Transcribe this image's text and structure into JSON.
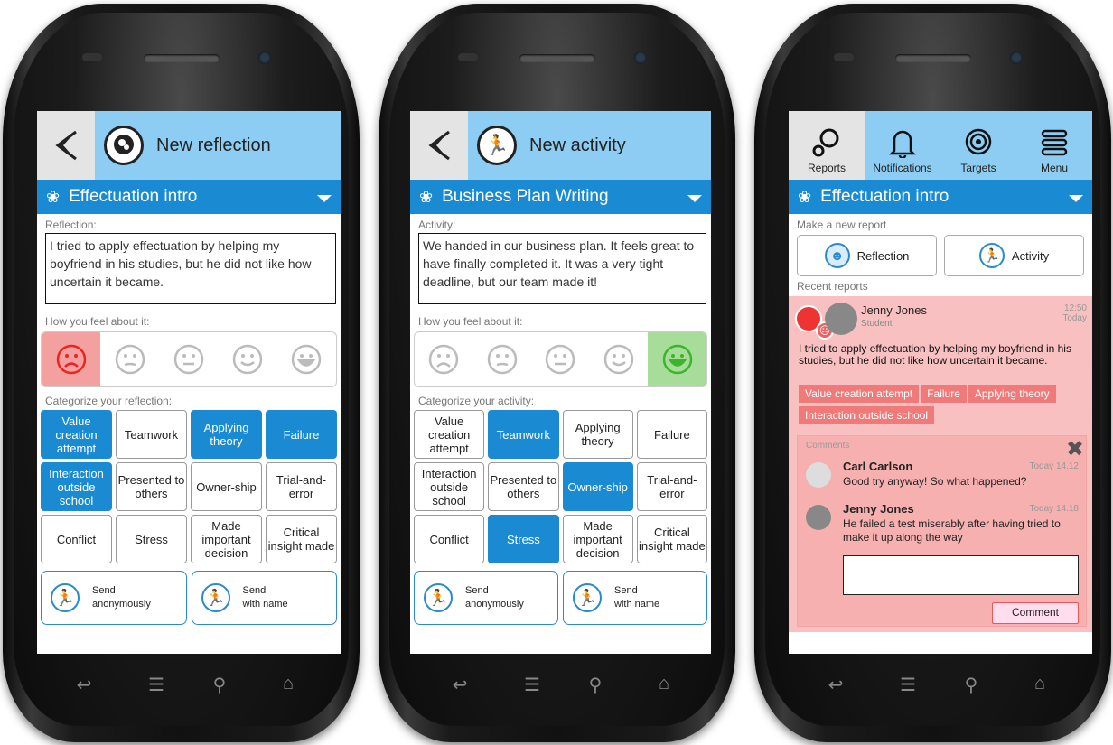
{
  "nav_icons": [
    "back-key",
    "menu-key",
    "search-key",
    "home-key"
  ],
  "phone1": {
    "title": "New reflection",
    "group": "Effectuation intro",
    "text_label": "Reflection:",
    "text_value": "I tried to apply effectuation by helping my boyfriend in his studies, but he did not like how uncertain it became.",
    "feel_label": "How you feel about it:",
    "selected_face": 0,
    "cat_label": "Categorize  your reflection:",
    "categories": [
      {
        "label": "Value creation attempt",
        "selected": true
      },
      {
        "label": "Teamwork",
        "selected": false
      },
      {
        "label": "Applying theory",
        "selected": true
      },
      {
        "label": "Failure",
        "selected": true
      },
      {
        "label": "Interaction outside school",
        "selected": true
      },
      {
        "label": "Presented to others",
        "selected": false
      },
      {
        "label": "Owner-ship",
        "selected": false
      },
      {
        "label": "Trial-and-error",
        "selected": false
      },
      {
        "label": "Conflict",
        "selected": false
      },
      {
        "label": "Stress",
        "selected": false
      },
      {
        "label": "Made important decision",
        "selected": false
      },
      {
        "label": "Critical insight made",
        "selected": false
      }
    ],
    "send_anon": [
      "Send",
      "anonymously"
    ],
    "send_name": [
      "Send",
      "with name"
    ]
  },
  "phone2": {
    "title": "New activity",
    "group": "Business Plan Writing",
    "text_label": "Activity:",
    "text_value": "We handed in our business plan. It feels great to have finally completed it. It was a very tight deadline, but our team made it!",
    "feel_label": "How you feel about it:",
    "selected_face": 4,
    "cat_label": "Categorize  your activity:",
    "categories": [
      {
        "label": "Value creation attempt",
        "selected": false
      },
      {
        "label": "Teamwork",
        "selected": true
      },
      {
        "label": "Applying theory",
        "selected": false
      },
      {
        "label": "Failure",
        "selected": false
      },
      {
        "label": "Interaction outside school",
        "selected": false
      },
      {
        "label": "Presented to others",
        "selected": false
      },
      {
        "label": "Owner-ship",
        "selected": true
      },
      {
        "label": "Trial-and-error",
        "selected": false
      },
      {
        "label": "Conflict",
        "selected": false
      },
      {
        "label": "Stress",
        "selected": true
      },
      {
        "label": "Made important decision",
        "selected": false
      },
      {
        "label": "Critical insight made",
        "selected": false
      }
    ],
    "send_anon": [
      "Send",
      "anonymously"
    ],
    "send_name": [
      "Send",
      "with name"
    ]
  },
  "phone3": {
    "tabs": [
      "Reports",
      "Notifications",
      "Targets",
      "Menu"
    ],
    "group": "Effectuation intro",
    "new_report_label": "Make  a new report",
    "reflection_btn": "Reflection",
    "activity_btn": "Activity",
    "recent_label": "Recent reports",
    "report": {
      "author": "Jenny Jones",
      "role": "Student",
      "time": "12:50",
      "day": "Today",
      "text": "I tried to apply effectuation by helping my boyfriend in his studies, but he did not like how uncertain it became.",
      "tags": [
        "Value creation attempt",
        "Failure",
        "Applying theory",
        "Interaction outside school"
      ]
    },
    "comments_label": "Comments",
    "comments": [
      {
        "author": "Carl Carlson",
        "time": "Today 14.12",
        "text": "Good try anyway! So what happened?"
      },
      {
        "author": "Jenny Jones",
        "time": "Today 14.18",
        "text": "He failed a test miserably after having tried to make it up along the way"
      }
    ],
    "comment_input": "",
    "comment_btn": "Comment"
  }
}
